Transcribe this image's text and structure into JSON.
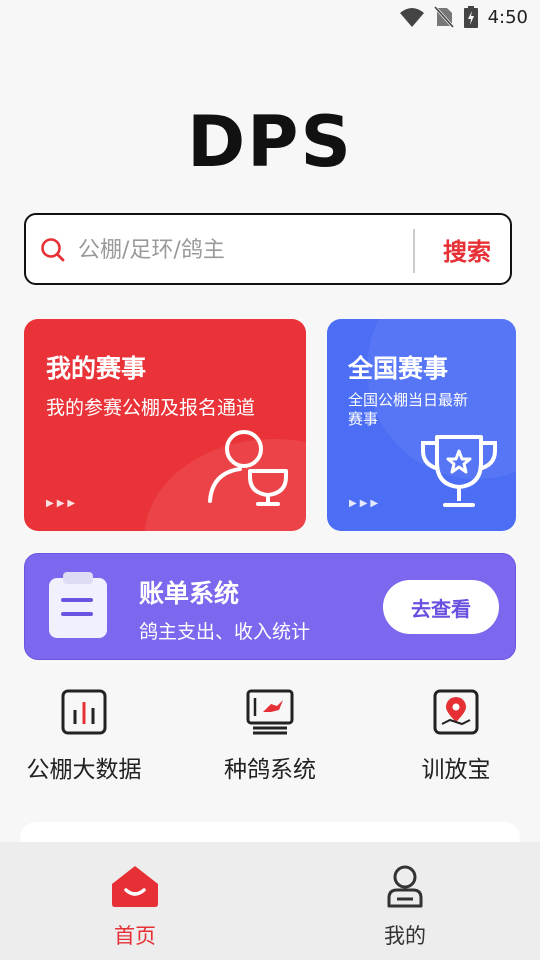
{
  "status_bar": {
    "time": "4:50"
  },
  "logo": {
    "text": "DPS"
  },
  "search": {
    "placeholder": "公棚/足环/鸽主",
    "button_label": "搜索"
  },
  "cards": {
    "my_events": {
      "title": "我的赛事",
      "subtitle": "我的参赛公棚及报名通道"
    },
    "national_events": {
      "title": "全国赛事",
      "subtitle": "全国公棚当日最新赛事"
    }
  },
  "bill": {
    "title": "账单系统",
    "subtitle": "鸽主支出、收入统计",
    "button_label": "去查看"
  },
  "tools": [
    {
      "label": "公棚大数据",
      "icon": "bar-chart-icon"
    },
    {
      "label": "种鸽系统",
      "icon": "pigeon-monitor-icon"
    },
    {
      "label": "训放宝",
      "icon": "map-pin-icon"
    }
  ],
  "tabbar": {
    "tabs": [
      {
        "label": "首页",
        "active": true,
        "icon": "home-icon"
      },
      {
        "label": "我的",
        "active": false,
        "icon": "user-icon"
      }
    ],
    "active_color": "#e63035",
    "inactive_color": "#333333"
  },
  "colors": {
    "red": "#ea3338",
    "blue": "#4c6ef5",
    "purple": "#7b68ee"
  }
}
